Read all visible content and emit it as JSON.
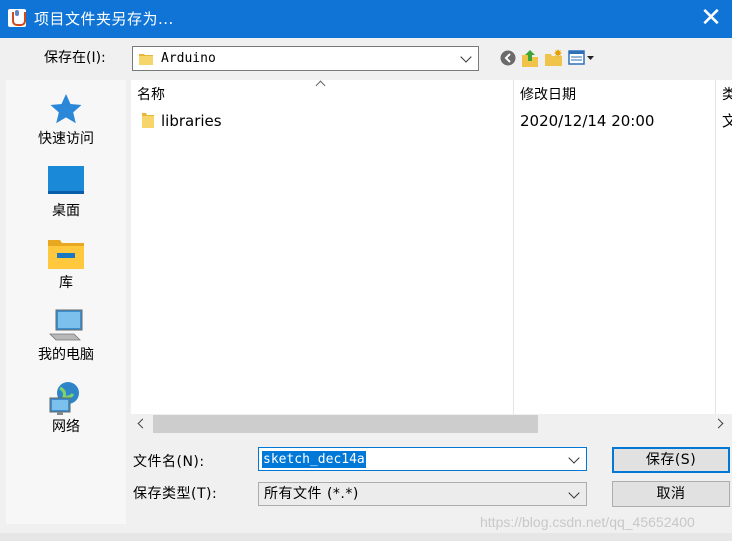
{
  "window": {
    "title": "项目文件夹另存为...",
    "close_glyph": "✕",
    "accent": "#0f74d6"
  },
  "lookin": {
    "label": "保存在(I):",
    "value": "Arduino",
    "icon": "folder-icon"
  },
  "toolbar": {
    "back_icon": "back-icon",
    "up_icon": "up-folder-icon",
    "new_folder_icon": "new-folder-icon",
    "view_menu_icon": "view-menu-icon"
  },
  "places": [
    {
      "label": "快速访问",
      "icon": "star-icon"
    },
    {
      "label": "桌面",
      "icon": "desktop-icon"
    },
    {
      "label": "库",
      "icon": "library-icon"
    },
    {
      "label": "我的电脑",
      "icon": "computer-icon"
    },
    {
      "label": "网络",
      "icon": "network-icon"
    }
  ],
  "filelist": {
    "columns": [
      "名称",
      "修改日期",
      "类"
    ],
    "rows": [
      {
        "name": "libraries",
        "modified": "2020/12/14 20:00",
        "type": "文",
        "icon": "folder-icon"
      }
    ]
  },
  "form": {
    "filename_label": "文件名(N):",
    "filename_value": "sketch_dec14a",
    "filetype_label": "保存类型(T):",
    "filetype_value": "所有文件 (*.*)",
    "save_label": "保存(S)",
    "cancel_label": "取消"
  },
  "watermark": "https://blog.csdn.net/qq_45652400"
}
